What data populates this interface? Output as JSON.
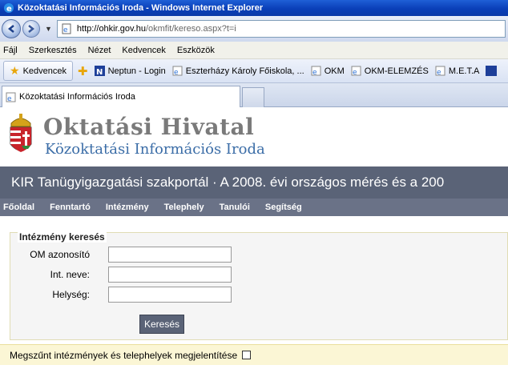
{
  "window": {
    "title": "Közoktatási Információs Iroda - Windows Internet Explorer"
  },
  "address": {
    "url_host": "http://ohkir.gov.hu",
    "url_path": "/okmfit/kereso.aspx?t=i"
  },
  "menu": [
    "Fájl",
    "Szerkesztés",
    "Nézet",
    "Kedvencek",
    "Eszközök"
  ],
  "favorites": {
    "main_label": "Kedvencek",
    "items": [
      "Neptun - Login",
      "Eszterházy Károly Főiskola, ...",
      "OKM",
      "OKM-ELEMZÉS",
      "M.E.T.A"
    ]
  },
  "tab": {
    "label": "Közoktatási Információs Iroda"
  },
  "page": {
    "org_title": "Oktatási Hivatal",
    "org_subtitle": "Közoktatási Információs Iroda",
    "banner": "KIR Tanügyigazgatási szakportál · A 2008. évi országos mérés és a 200",
    "nav": [
      "Főoldal",
      "Fenntartó",
      "Intézmény",
      "Telephely",
      "Tanulói",
      "Segítség"
    ],
    "search": {
      "legend": "Intézmény keresés",
      "fields": [
        {
          "label": "OM azonosító",
          "value": ""
        },
        {
          "label": "Int. neve:",
          "value": ""
        },
        {
          "label": "Helység:",
          "value": ""
        }
      ],
      "button": "Keresés"
    },
    "notice": "Megszűnt intézmények és telephelyek megjelentítése"
  },
  "colors": {
    "banner": "#5a6377",
    "nav": "#6a7287",
    "subtitle": "#3b6da7",
    "notice_bg": "#fbf6d5"
  }
}
